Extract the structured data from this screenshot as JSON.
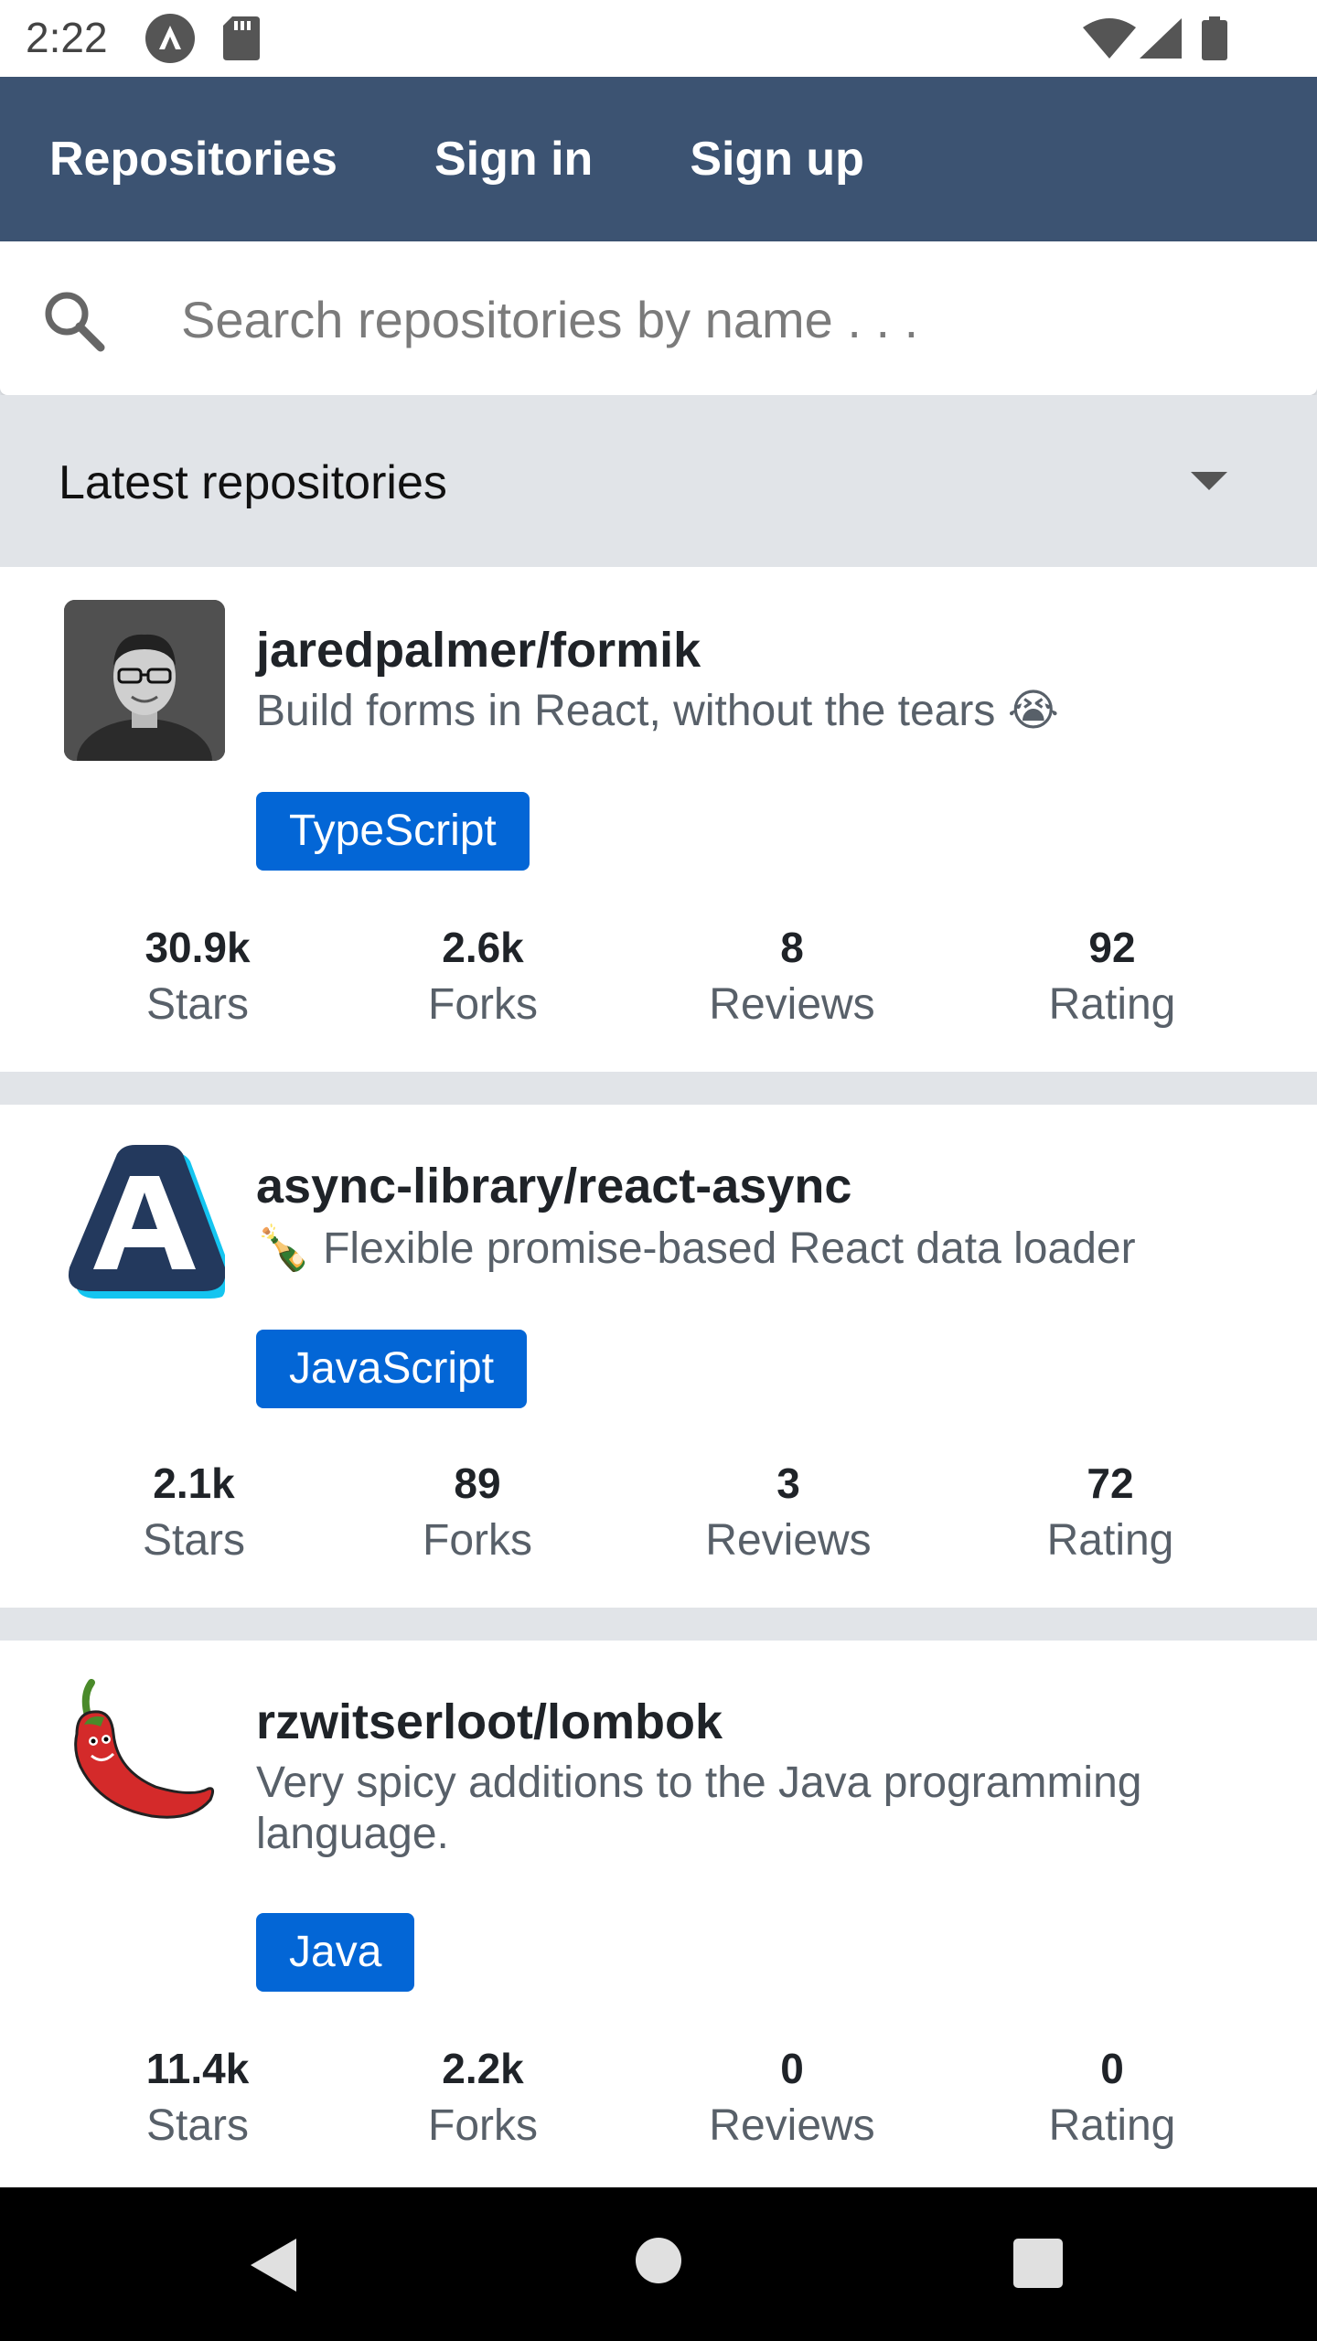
{
  "status_bar": {
    "time": "2:22",
    "icons": [
      "a-icon",
      "sd-card-icon",
      "wifi-icon",
      "signal-icon",
      "battery-icon"
    ]
  },
  "app_bar": {
    "tabs": [
      {
        "label": "Repositories"
      },
      {
        "label": "Sign in"
      },
      {
        "label": "Sign up"
      }
    ],
    "background": "#3c5372"
  },
  "search": {
    "placeholder": "Search repositories by name . . .",
    "value": ""
  },
  "sort": {
    "selected": "Latest repositories"
  },
  "accent_color": "#0366d6",
  "repositories": [
    {
      "full_name": "jaredpalmer/formik",
      "description": "Build forms in React, without the tears 😭",
      "language": "TypeScript",
      "avatar_icon": "person-avatar",
      "stats": [
        {
          "value": "30.9k",
          "label": "Stars"
        },
        {
          "value": "2.6k",
          "label": "Forks"
        },
        {
          "value": "8",
          "label": "Reviews"
        },
        {
          "value": "92",
          "label": "Rating"
        }
      ]
    },
    {
      "full_name": "async-library/react-async",
      "description": "🍾 Flexible promise-based React data loader",
      "language": "JavaScript",
      "avatar_icon": "letter-a-logo",
      "stats": [
        {
          "value": "2.1k",
          "label": "Stars"
        },
        {
          "value": "89",
          "label": "Forks"
        },
        {
          "value": "3",
          "label": "Reviews"
        },
        {
          "value": "72",
          "label": "Rating"
        }
      ]
    },
    {
      "full_name": "rzwitserloot/lombok",
      "description": "Very spicy additions to the Java programming language.",
      "language": "Java",
      "avatar_icon": "chili-pepper-logo",
      "stats": [
        {
          "value": "11.4k",
          "label": "Stars"
        },
        {
          "value": "2.2k",
          "label": "Forks"
        },
        {
          "value": "0",
          "label": "Reviews"
        },
        {
          "value": "0",
          "label": "Rating"
        }
      ]
    }
  ],
  "nav_bar": {
    "icons": [
      "back-icon",
      "home-icon",
      "recents-icon"
    ]
  }
}
